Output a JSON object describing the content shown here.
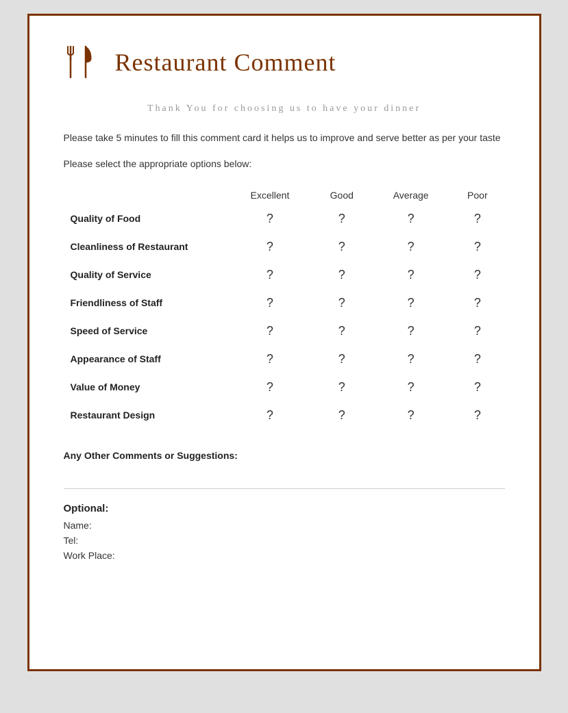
{
  "header": {
    "title": "Restaurant Comment"
  },
  "thank_you": "Thank You for choosing us to have your\ndinner",
  "description": "Please take 5 minutes to fill this comment card it helps us to improve\nand serve better as per your taste",
  "instruction": "Please select the appropriate options below:",
  "columns": [
    "",
    "Excellent",
    "Good",
    "Average",
    "Poor"
  ],
  "rows": [
    {
      "label": "Quality of Food",
      "values": [
        "?",
        "?",
        "?",
        "?"
      ]
    },
    {
      "label": "Cleanliness of Restaurant",
      "values": [
        "?",
        "?",
        "?",
        "?"
      ]
    },
    {
      "label": "Quality of Service",
      "values": [
        "?",
        "?",
        "?",
        "?"
      ]
    },
    {
      "label": "Friendliness of Staff",
      "values": [
        "?",
        "?",
        "?",
        "?"
      ]
    },
    {
      "label": "Speed of Service",
      "values": [
        "?",
        "?",
        "?",
        "?"
      ]
    },
    {
      "label": "Appearance of Staff",
      "values": [
        "?",
        "?",
        "?",
        "?"
      ]
    },
    {
      "label": "Value of Money",
      "values": [
        "?",
        "?",
        "?",
        "?"
      ]
    },
    {
      "label": "Restaurant Design",
      "values": [
        "?",
        "?",
        "?",
        "?"
      ]
    }
  ],
  "comments_label": "Any Other Comments or Suggestions:",
  "optional": {
    "label": "Optional:",
    "fields": [
      "Name:",
      "Tel:",
      "Work Place:"
    ]
  },
  "colors": {
    "brand": "#7B3300",
    "border": "#7B3300"
  }
}
